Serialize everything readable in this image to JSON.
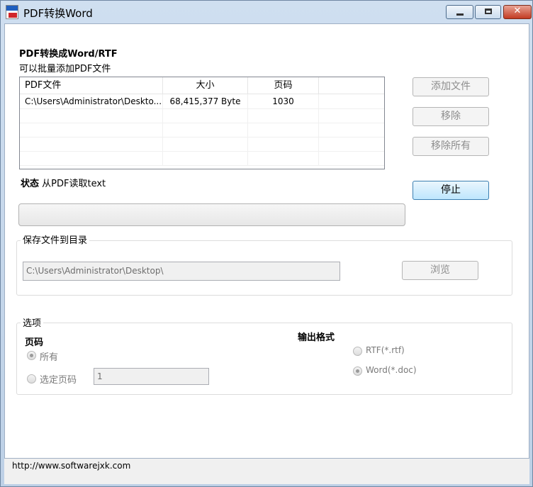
{
  "window": {
    "title": "PDF转换Word"
  },
  "header": {
    "title": "PDF转换成Word/RTF",
    "subtitle": "可以批量添加PDF文件"
  },
  "file_list": {
    "columns": [
      "PDF文件",
      "大小",
      "页码"
    ],
    "rows": [
      {
        "file": "C:\\Users\\Administrator\\Deskto...",
        "size": "68,415,377 Byte",
        "pages": "1030"
      }
    ]
  },
  "buttons": {
    "add_file": "添加文件",
    "remove": "移除",
    "remove_all": "移除所有",
    "stop": "停止",
    "browse": "浏览"
  },
  "status": {
    "label": "状态",
    "text": "从PDF读取text",
    "progress": 0
  },
  "save_dir": {
    "group_label": "保存文件到目录",
    "path": "C:\\Users\\Administrator\\Desktop\\"
  },
  "options": {
    "group_label": "选项",
    "pages_heading": "页码",
    "all_label": "所有",
    "select_label": "选定页码",
    "page_value": "1",
    "format_heading": "输出格式",
    "rtf_label": "RTF(*.rtf)",
    "word_label": "Word(*.doc)"
  },
  "footer": {
    "url": "http://www.softwarejxk.com"
  }
}
